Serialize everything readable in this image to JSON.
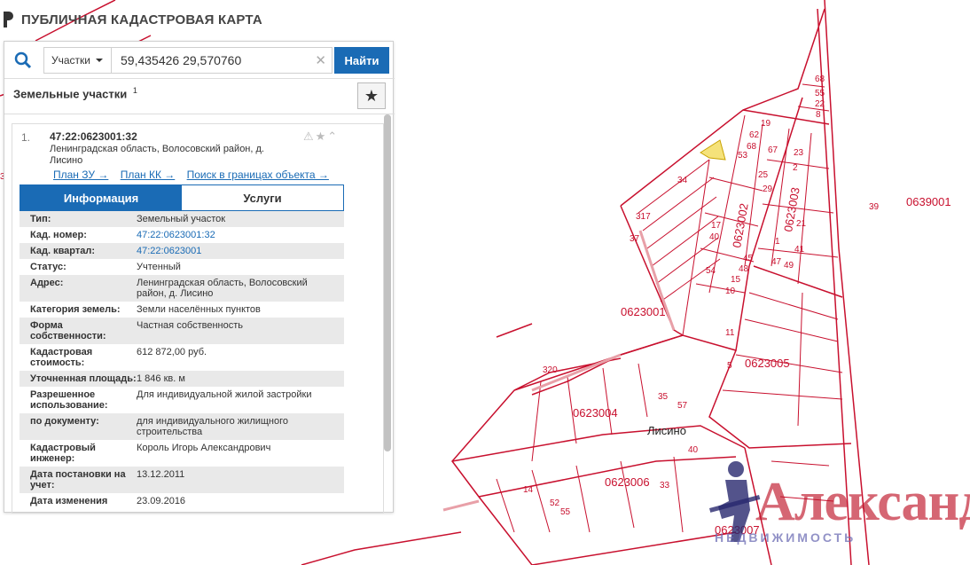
{
  "app": {
    "title": "ПУБЛИЧНАЯ КАДАСТРОВАЯ КАРТА",
    "logo_icon": "cadastral-logo-icon"
  },
  "search": {
    "type_label": "Участки",
    "query": "59,435426 29,570760",
    "clear_icon": "close-icon",
    "find_label": "Найти",
    "search_icon": "magnifier-icon"
  },
  "results": {
    "title": "Земельные участки",
    "count": "1",
    "favorite_icon": "star-icon"
  },
  "parcel": {
    "index": "1.",
    "cadastral_number": "47:22:0623001:32",
    "address": "Ленинградская область, Волосовский район, д. Лисино",
    "actions": "⚠★⌃",
    "links": [
      "План ЗУ →",
      "План КК →",
      "Поиск в границах объекта →"
    ],
    "tabs": [
      "Информация",
      "Услуги"
    ],
    "info": [
      {
        "label": "Тип:",
        "value": "Земельный участок"
      },
      {
        "label": "Кад. номер:",
        "value": "47:22:0623001:32"
      },
      {
        "label": "Кад. квартал:",
        "value": "47:22:0623001"
      },
      {
        "label": "Статус:",
        "value": "Учтенный"
      },
      {
        "label": "Адрес:",
        "value": "Ленинградская область, Волосовский район, д. Лисино"
      },
      {
        "label": "Категория земель:",
        "value": "Земли населённых пунктов"
      },
      {
        "label": "Форма собственности:",
        "value": "Частная собственность"
      },
      {
        "label": "Кадастровая стоимость:",
        "value": "612 872,00 руб."
      },
      {
        "label": "Уточненная площадь:",
        "value": "1 846 кв. м"
      },
      {
        "label": "Разрешенное использование:",
        "value": "Для индивидуальной жилой застройки"
      },
      {
        "label": "по документу:",
        "value": "для индивидуального жилищного строительства"
      },
      {
        "label": "Кадастровый инженер:",
        "value": "Король Игорь Александрович"
      },
      {
        "label": "Дата постановки на учет:",
        "value": "13.12.2011"
      },
      {
        "label": "Дата изменения",
        "value": "23.09.2016"
      }
    ]
  },
  "map": {
    "quarters": [
      "0623001",
      "0623002",
      "0623003",
      "0623004",
      "0623005",
      "0623006",
      "0623007",
      "0639001"
    ],
    "village_label": "Лисино",
    "edge_numbers": [
      "39",
      "37"
    ],
    "parcel_numbers": [
      "19",
      "62",
      "68",
      "67",
      "53",
      "34",
      "23",
      "29",
      "25",
      "317",
      "37",
      "17",
      "40",
      "45",
      "48",
      "54",
      "15",
      "10",
      "21",
      "1",
      "47",
      "49",
      "41",
      "2",
      "5",
      "11",
      "22",
      "55",
      "68",
      "8",
      "320",
      "35",
      "57",
      "40",
      "33",
      "52",
      "55",
      "14"
    ]
  },
  "watermark": {
    "text": "Александр",
    "subtext": "НЕДВИЖИМОСТЬ"
  }
}
